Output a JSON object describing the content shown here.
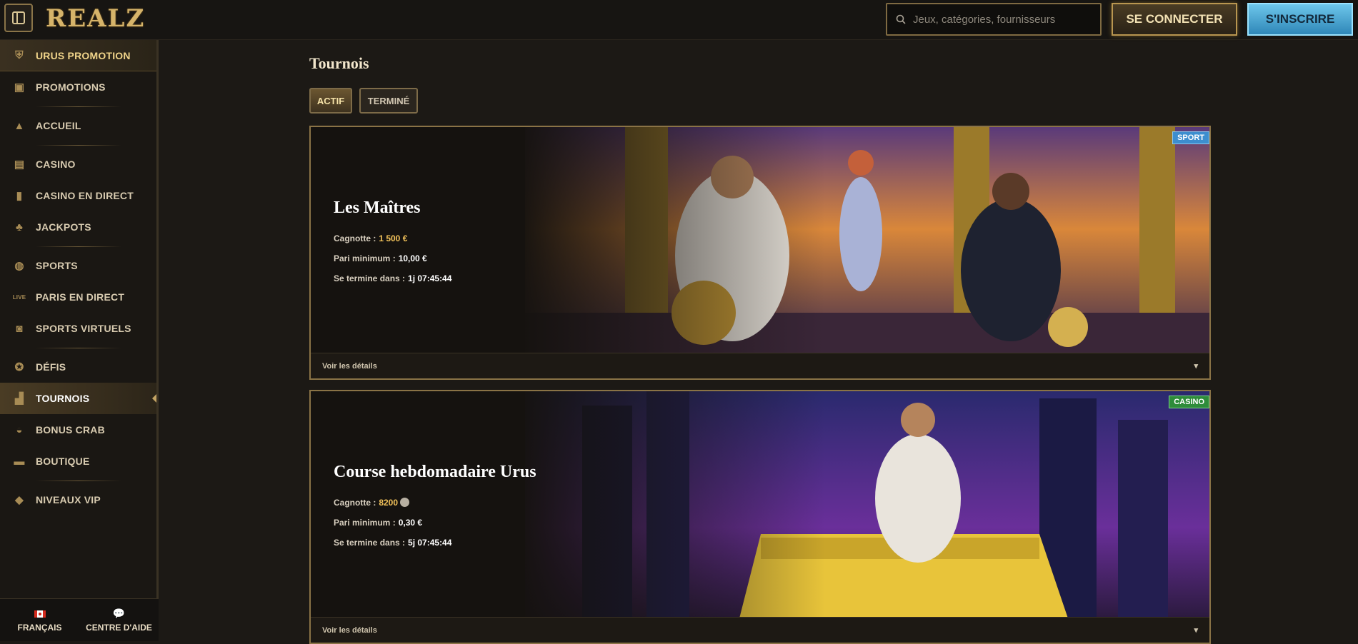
{
  "header": {
    "logo": "REALZ",
    "search_placeholder": "Jeux, catégories, fournisseurs",
    "login_label": "SE CONNECTER",
    "signup_label": "S'INSCRIRE"
  },
  "sidebar": {
    "items": [
      {
        "label": "URUS PROMOTION",
        "icon": "helmet-icon"
      },
      {
        "label": "PROMOTIONS",
        "icon": "gift-icon"
      },
      {
        "label": "ACCUEIL",
        "icon": "pyramid-icon"
      },
      {
        "label": "CASINO",
        "icon": "slot-machine-icon"
      },
      {
        "label": "CASINO EN DIRECT",
        "icon": "cards-icon"
      },
      {
        "label": "JACKPOTS",
        "icon": "clover-icon"
      },
      {
        "label": "SPORTS",
        "icon": "ball-icon"
      },
      {
        "label": "PARIS EN DIRECT",
        "icon": "live-icon"
      },
      {
        "label": "SPORTS VIRTUELS",
        "icon": "virtual-sports-icon"
      },
      {
        "label": "DÉFIS",
        "icon": "medal-icon"
      },
      {
        "label": "TOURNOIS",
        "icon": "podium-icon"
      },
      {
        "label": "BONUS CRAB",
        "icon": "crab-icon"
      },
      {
        "label": "BOUTIQUE",
        "icon": "bag-icon"
      },
      {
        "label": "NIVEAUX VIP",
        "icon": "diamond-icon"
      }
    ],
    "bottom": {
      "language": "FRANÇAIS",
      "help": "CENTRE D'AIDE"
    }
  },
  "main": {
    "title": "Tournois",
    "tabs": [
      {
        "label": "ACTIF"
      },
      {
        "label": "TERMINÉ"
      }
    ],
    "tournaments": [
      {
        "badge": "SPORT",
        "title": "Les Maîtres",
        "prize_label": "Cagnotte :",
        "prize_value": "1 500 €",
        "min_bet_label": "Pari minimum :",
        "min_bet_value": "10,00 €",
        "ends_label": "Se termine dans :",
        "ends_value": "1j 07:45:44",
        "details": "Voir les détails"
      },
      {
        "badge": "CASINO",
        "title": "Course hebdomadaire Urus",
        "prize_label": "Cagnotte :",
        "prize_value": "8200",
        "min_bet_label": "Pari minimum :",
        "min_bet_value": "0,30 €",
        "ends_label": "Se termine dans :",
        "ends_value": "5j 07:45:44",
        "details": "Voir les détails"
      }
    ]
  },
  "colors": {
    "gold": "#c4a464",
    "sport_badge": "#3d8ecf",
    "casino_badge": "#2e8c3a",
    "signup": "#4aa8d8"
  }
}
